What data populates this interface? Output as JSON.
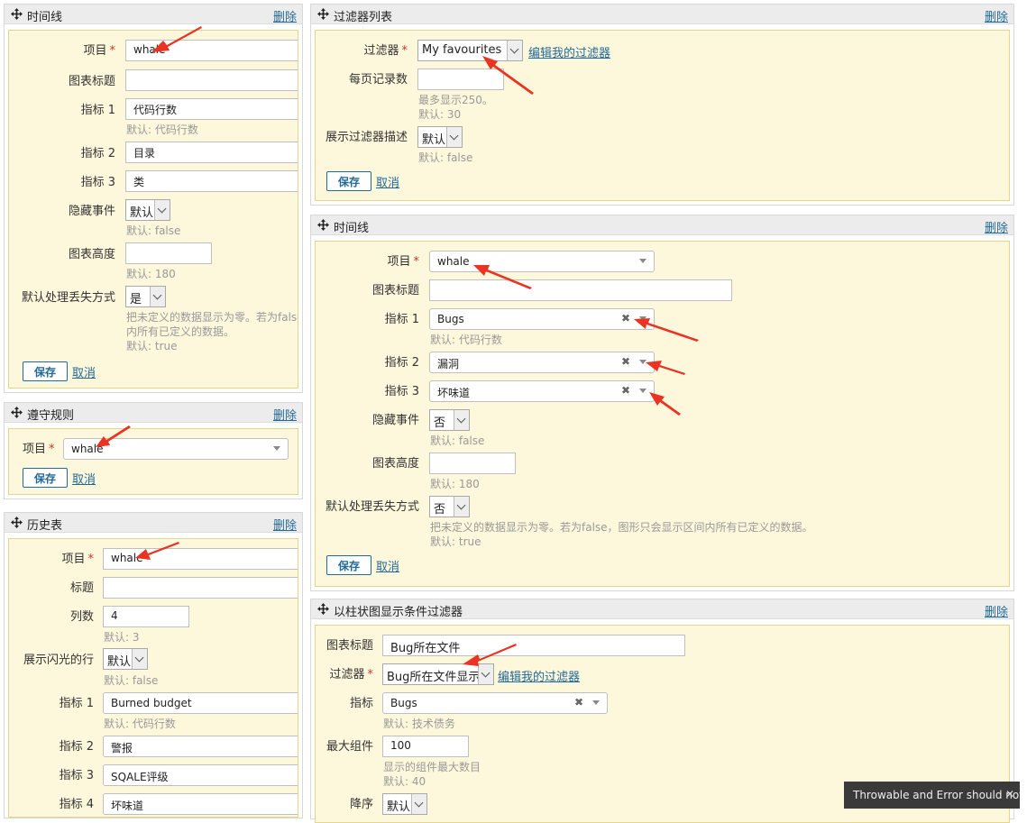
{
  "common": {
    "delete": "删除",
    "save": "保存",
    "cancel": "取消"
  },
  "w1": {
    "title": "时间线",
    "project_label": "项目",
    "project_value": "whale",
    "chart_title_label": "图表标题",
    "metric1_label": "指标 1",
    "metric1_value": "代码行数",
    "metric1_default": "默认: 代码行数",
    "metric2_label": "指标 2",
    "metric2_value": "目录",
    "metric3_label": "指标 3",
    "metric3_value": "类",
    "hide_events_label": "隐藏事件",
    "hide_events_value": "默认",
    "hide_events_default": "默认: false",
    "chart_height_label": "图表高度",
    "chart_height_default": "默认: 180",
    "missing_label": "默认处理丢失方式",
    "missing_value": "是",
    "missing_hint1": "把未定义的数据显示为零。若为false",
    "missing_hint2": "内所有已定义的数据。",
    "missing_default": "默认: true"
  },
  "w2": {
    "title": "过滤器列表",
    "filter_label": "过滤器",
    "filter_value": "My favourites",
    "edit_filters": "编辑我的过滤器",
    "page_size_label": "每页记录数",
    "page_size_hint": "最多显示250。",
    "page_size_default": "默认: 30",
    "show_desc_label": "展示过滤器描述",
    "show_desc_value": "默认",
    "show_desc_default": "默认: false"
  },
  "w3": {
    "title": "时间线",
    "project_label": "项目",
    "project_value": "whale",
    "chart_title_label": "图表标题",
    "metric1_label": "指标 1",
    "metric1_value": "Bugs",
    "metric1_default": "默认: 代码行数",
    "metric2_label": "指标 2",
    "metric2_value": "漏洞",
    "metric3_label": "指标 3",
    "metric3_value": "坏味道",
    "hide_events_label": "隐藏事件",
    "hide_events_value": "否",
    "hide_events_default": "默认: false",
    "chart_height_label": "图表高度",
    "chart_height_default": "默认: 180",
    "missing_label": "默认处理丢失方式",
    "missing_value": "否",
    "missing_hint": "把未定义的数据显示为零。若为false，图形只会显示区间内所有已定义的数据。",
    "missing_default": "默认: true"
  },
  "w4": {
    "title": "遵守规则",
    "project_label": "项目",
    "project_value": "whale"
  },
  "w5": {
    "title": "历史表",
    "project_label": "项目",
    "project_value": "whale",
    "title_label": "标题",
    "columns_label": "列数",
    "columns_value": "4",
    "columns_default": "默认: 3",
    "flash_label": "展示闪光的行",
    "flash_value": "默认",
    "flash_default": "默认: false",
    "metric1_label": "指标 1",
    "metric1_value": "Burned budget",
    "metric1_default": "默认: 代码行数",
    "metric2_label": "指标 2",
    "metric2_value": "警报",
    "metric3_label": "指标 3",
    "metric3_value": "SQALE评级",
    "metric4_label": "指标 4",
    "metric4_value": "坏味道"
  },
  "w6": {
    "title": "以柱状图显示条件过滤器",
    "chart_title_label": "图表标题",
    "chart_title_value": "Bug所在文件",
    "filter_label": "过滤器",
    "filter_value": "Bug所在文件显示",
    "edit_filters": "编辑我的过滤器",
    "metric_label": "指标",
    "metric_value": "Bugs",
    "metric_default": "默认: 技术债务",
    "max_components_label": "最大组件",
    "max_components_value": "100",
    "max_components_hint": "显示的组件最大数目",
    "max_components_default": "默认: 40",
    "sort_label": "降序",
    "sort_value": "默认"
  },
  "tooltip": {
    "text": "Throwable and Error should not..."
  },
  "colors": {
    "accent": "#236a97",
    "panel_bg": "#fdf7dc",
    "panel_border": "#e6d68c",
    "header_bg": "#ececec",
    "required": "#c0392b",
    "annotation_arrow": "#ea3323"
  }
}
